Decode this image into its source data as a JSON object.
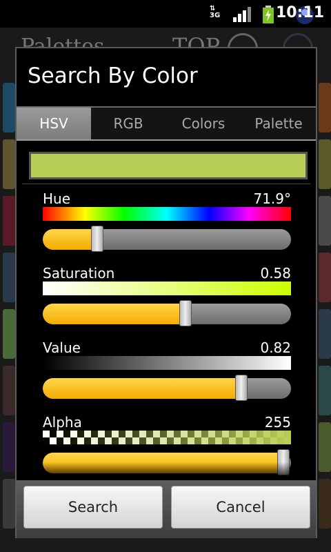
{
  "status_bar": {
    "network": "3G",
    "time": "10:11",
    "icons": [
      "data-arrows-icon",
      "signal-icon",
      "battery-charging-icon",
      "avatar-icon"
    ]
  },
  "background_app": {
    "title": "Palettes",
    "top_label": "TOP"
  },
  "dialog": {
    "title": "Search By Color",
    "tabs": [
      {
        "label": "HSV",
        "active": true
      },
      {
        "label": "RGB",
        "active": false
      },
      {
        "label": "Colors",
        "active": false
      },
      {
        "label": "Palette",
        "active": false
      }
    ],
    "preview_color": "#b8cf55",
    "sliders": [
      {
        "label": "Hue",
        "value": "71.9°",
        "level": 0.22
      },
      {
        "label": "Saturation",
        "value": "0.58",
        "level": 0.575
      },
      {
        "label": "Value",
        "value": "0.82",
        "level": 0.8
      },
      {
        "label": "Alpha",
        "value": "255",
        "level": 0.97
      }
    ],
    "buttons": {
      "search": "Search",
      "cancel": "Cancel"
    }
  },
  "colors": {
    "accent": "#f4ac00",
    "selected_color": "#b8cf55"
  }
}
